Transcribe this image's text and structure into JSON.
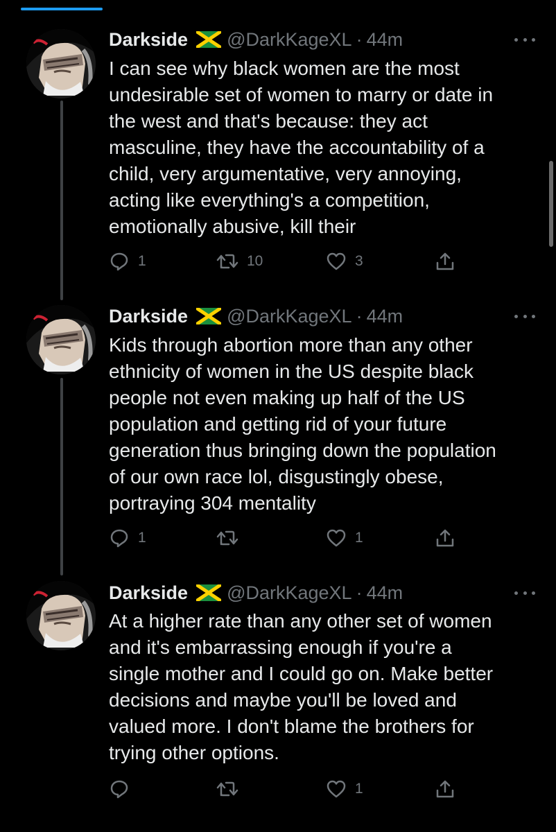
{
  "colors": {
    "background": "#000000",
    "text": "#e7e9ea",
    "secondary": "#71767b",
    "accent": "#1d9bf0",
    "thread_line": "#3e4144"
  },
  "icons": {
    "flag": "jamaica-flag-icon",
    "more": "more-horizontal-icon",
    "reply": "reply-icon",
    "retweet": "retweet-icon",
    "like": "heart-icon",
    "share": "share-icon"
  },
  "tweets": [
    {
      "name": "Darkside",
      "handle": "@DarkKageXL",
      "separator": "·",
      "time": "44m",
      "text": "I can see why black women are the most\nundesirable set of women to marry or date in\nthe west and that's because: they act\nmasculine, they have the accountability of a\nchild, very argumentative, very annoying,\nacting like everything's a competition,\nemotionally abusive, kill their",
      "replies": "1",
      "retweets": "10",
      "likes": "3"
    },
    {
      "name": "Darkside",
      "handle": "@DarkKageXL",
      "separator": "·",
      "time": "44m",
      "text": "Kids through abortion more than any other\nethnicity of women in the US despite black\npeople not even making up half of the US\npopulation and getting rid of your future\ngeneration thus bringing down the population\nof  our own race lol, disgustingly obese,\nportraying 304 mentality",
      "replies": "1",
      "retweets": "",
      "likes": "1"
    },
    {
      "name": "Darkside",
      "handle": "@DarkKageXL",
      "separator": "·",
      "time": "44m",
      "text": "At a higher rate than any other set of women\nand it's embarrassing enough if you're a\nsingle mother and I could go on. Make better\ndecisions and maybe you'll be loved and\nvalued more. I don't blame the brothers for\ntrying other options.",
      "replies": "",
      "retweets": "",
      "likes": "1"
    }
  ]
}
